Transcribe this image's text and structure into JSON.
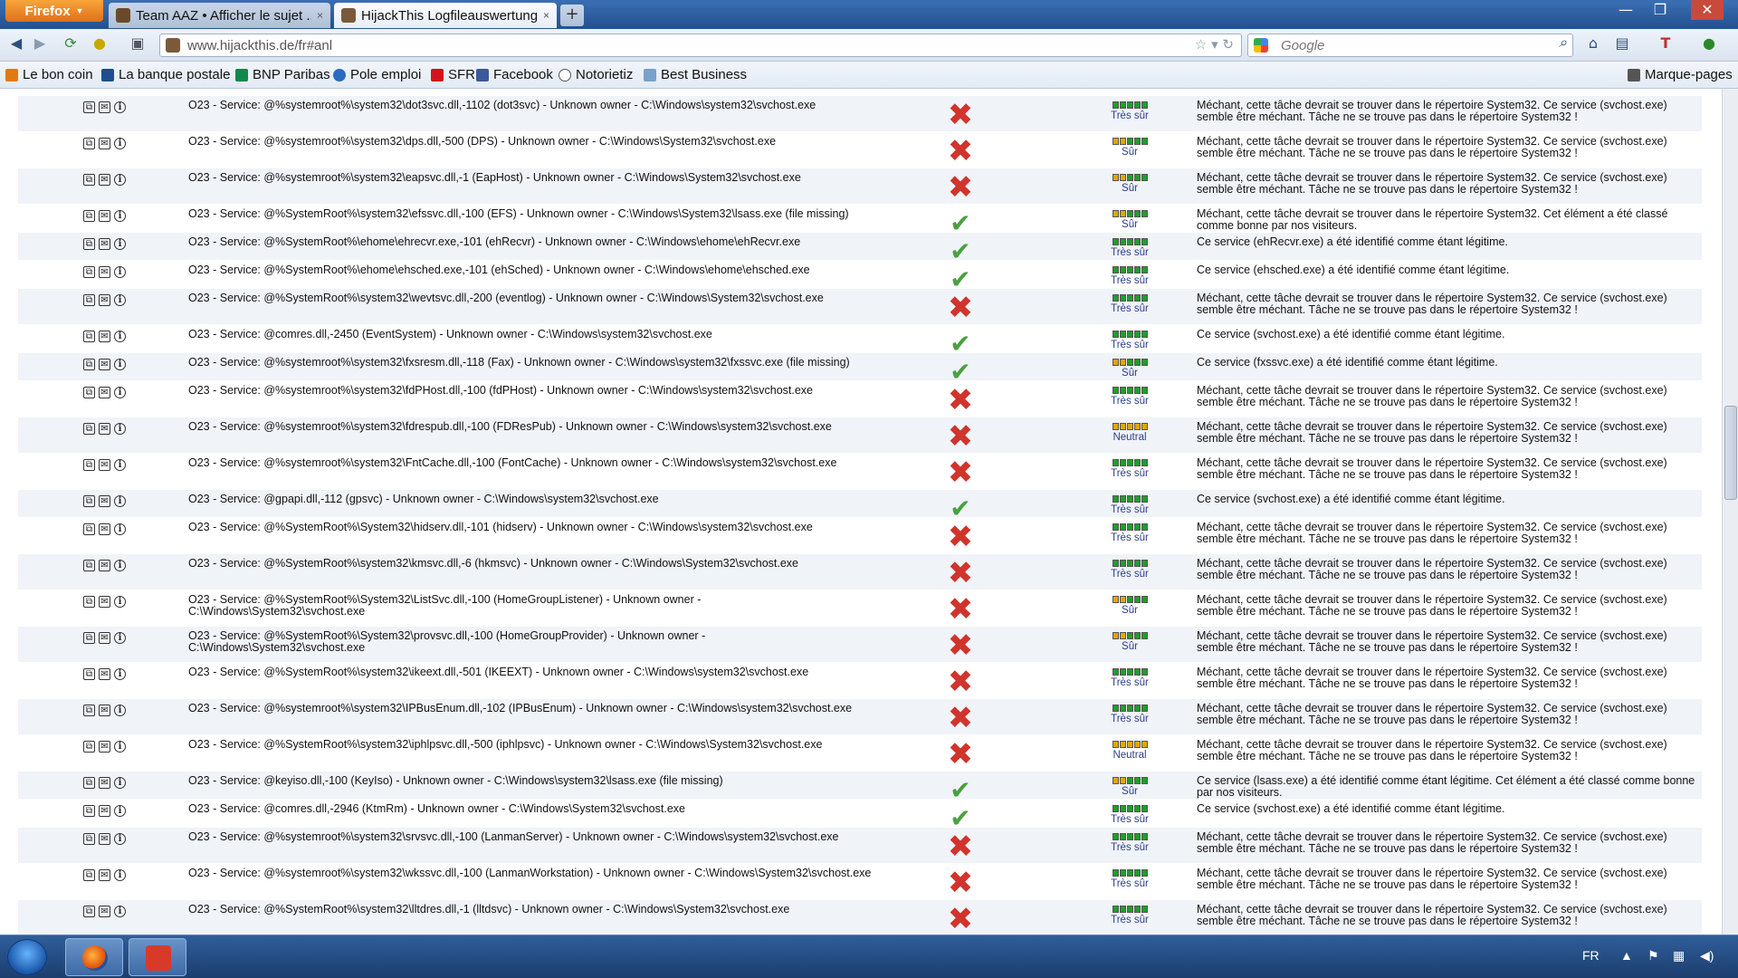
{
  "browser": {
    "menu_label": "Firefox",
    "tabs": [
      {
        "label": "Team AAZ • Afficher le sujet ...",
        "close": "×"
      },
      {
        "label": "HijackThis Logfileauswertung",
        "close": "×"
      }
    ],
    "newtab": "+",
    "url": "www.hijackthis.de/fr#anl",
    "search_placeholder": "Google",
    "bookmarks": [
      {
        "label": "Le bon coin",
        "color": "#e07a10"
      },
      {
        "label": "La banque postale",
        "color": "#1f4d8f"
      },
      {
        "label": "BNP Paribas",
        "color": "#0f8a4a"
      },
      {
        "label": "Pole emploi",
        "color": "#2a6bbf"
      },
      {
        "label": "SFR",
        "color": "#d4131b"
      },
      {
        "label": "Facebook",
        "color": "#3b5998"
      },
      {
        "label": "Notorietiz",
        "color": "#555555"
      },
      {
        "label": "Best Business",
        "color": "#7aa0cc"
      }
    ],
    "bookmarks_menu": "Marque-pages"
  },
  "rows": [
    {
      "entry": "O23 - Service: @%systemroot%\\system32\\dot3svc.dll,-1102 (dot3svc) - Unknown owner - C:\\Windows\\system32\\svchost.exe",
      "status": "bad",
      "rating": "Très sûr",
      "desc": "Méchant, cette tâche devrait se trouver dans le répertoire System32. Ce service (svchost.exe) semble être méchant. Tâche ne se trouve pas dans le répertoire System32 !"
    },
    {
      "entry": "O23 - Service: @%systemroot%\\system32\\dps.dll,-500 (DPS) - Unknown owner - C:\\Windows\\System32\\svchost.exe",
      "status": "bad",
      "rating": "Sûr",
      "desc": "Méchant, cette tâche devrait se trouver dans le répertoire System32. Ce service (svchost.exe) semble être méchant. Tâche ne se trouve pas dans le répertoire System32 !"
    },
    {
      "entry": "O23 - Service: @%systemroot%\\system32\\eapsvc.dll,-1 (EapHost) - Unknown owner - C:\\Windows\\System32\\svchost.exe",
      "status": "bad",
      "rating": "Sûr",
      "desc": "Méchant, cette tâche devrait se trouver dans le répertoire System32. Ce service (svchost.exe) semble être méchant. Tâche ne se trouve pas dans le répertoire System32 !"
    },
    {
      "entry": "O23 - Service: @%SystemRoot%\\system32\\efssvc.dll,-100 (EFS) - Unknown owner - C:\\Windows\\System32\\lsass.exe (file missing)",
      "status": "good",
      "rating": "Sûr",
      "desc": "Méchant, cette tâche devrait se trouver dans le répertoire System32. Cet élément a été classé comme bonne par nos visiteurs."
    },
    {
      "entry": "O23 - Service: @%SystemRoot%\\ehome\\ehrecvr.exe,-101 (ehRecvr) - Unknown owner - C:\\Windows\\ehome\\ehRecvr.exe",
      "status": "good",
      "rating": "Très sûr",
      "desc": "Ce service (ehRecvr.exe) a été identifié comme étant légitime."
    },
    {
      "entry": "O23 - Service: @%SystemRoot%\\ehome\\ehsched.exe,-101 (ehSched) - Unknown owner - C:\\Windows\\ehome\\ehsched.exe",
      "status": "good",
      "rating": "Très sûr",
      "desc": "Ce service (ehsched.exe) a été identifié comme étant légitime."
    },
    {
      "entry": "O23 - Service: @%SystemRoot%\\system32\\wevtsvc.dll,-200 (eventlog) - Unknown owner - C:\\Windows\\System32\\svchost.exe",
      "status": "bad",
      "rating": "Très sûr",
      "desc": "Méchant, cette tâche devrait se trouver dans le répertoire System32. Ce service (svchost.exe) semble être méchant. Tâche ne se trouve pas dans le répertoire System32 !"
    },
    {
      "entry": "O23 - Service: @comres.dll,-2450 (EventSystem) - Unknown owner - C:\\Windows\\system32\\svchost.exe",
      "status": "good",
      "rating": "Très sûr",
      "desc": "Ce service (svchost.exe) a été identifié comme étant légitime."
    },
    {
      "entry": "O23 - Service: @%systemroot%\\system32\\fxsresm.dll,-118 (Fax) - Unknown owner - C:\\Windows\\system32\\fxssvc.exe (file missing)",
      "status": "good",
      "rating": "Sûr",
      "desc": "Ce service (fxssvc.exe) a été identifié comme étant légitime."
    },
    {
      "entry": "O23 - Service: @%systemroot%\\system32\\fdPHost.dll,-100 (fdPHost) - Unknown owner - C:\\Windows\\system32\\svchost.exe",
      "status": "bad",
      "rating": "Très sûr",
      "desc": "Méchant, cette tâche devrait se trouver dans le répertoire System32. Ce service (svchost.exe) semble être méchant. Tâche ne se trouve pas dans le répertoire System32 !"
    },
    {
      "entry": "O23 - Service: @%systemroot%\\system32\\fdrespub.dll,-100 (FDResPub) - Unknown owner - C:\\Windows\\system32\\svchost.exe",
      "status": "bad",
      "rating": "Neutral",
      "desc": "Méchant, cette tâche devrait se trouver dans le répertoire System32. Ce service (svchost.exe) semble être méchant. Tâche ne se trouve pas dans le répertoire System32 !"
    },
    {
      "entry": "O23 - Service: @%systemroot%\\system32\\FntCache.dll,-100 (FontCache) - Unknown owner - C:\\Windows\\system32\\svchost.exe",
      "status": "bad",
      "rating": "Très sûr",
      "desc": "Méchant, cette tâche devrait se trouver dans le répertoire System32. Ce service (svchost.exe) semble être méchant. Tâche ne se trouve pas dans le répertoire System32 !"
    },
    {
      "entry": "O23 - Service: @gpapi.dll,-112 (gpsvc) - Unknown owner - C:\\Windows\\system32\\svchost.exe",
      "status": "good",
      "rating": "Très sûr",
      "desc": "Ce service (svchost.exe) a été identifié comme étant légitime."
    },
    {
      "entry": "O23 - Service: @%SystemRoot%\\System32\\hidserv.dll,-101 (hidserv) - Unknown owner - C:\\Windows\\system32\\svchost.exe",
      "status": "bad",
      "rating": "Très sûr",
      "desc": "Méchant, cette tâche devrait se trouver dans le répertoire System32. Ce service (svchost.exe) semble être méchant. Tâche ne se trouve pas dans le répertoire System32 !"
    },
    {
      "entry": "O23 - Service: @%SystemRoot%\\system32\\kmsvc.dll,-6 (hkmsvc) - Unknown owner - C:\\Windows\\System32\\svchost.exe",
      "status": "bad",
      "rating": "Très sûr",
      "desc": "Méchant, cette tâche devrait se trouver dans le répertoire System32. Ce service (svchost.exe) semble être méchant. Tâche ne se trouve pas dans le répertoire System32 !"
    },
    {
      "entry": "O23 - Service: @%SystemRoot%\\System32\\ListSvc.dll,-100 (HomeGroupListener) - Unknown owner - C:\\Windows\\System32\\svchost.exe",
      "status": "bad",
      "rating": "Sûr",
      "desc": "Méchant, cette tâche devrait se trouver dans le répertoire System32. Ce service (svchost.exe) semble être méchant. Tâche ne se trouve pas dans le répertoire System32 !"
    },
    {
      "entry": "O23 - Service: @%SystemRoot%\\System32\\provsvc.dll,-100 (HomeGroupProvider) - Unknown owner - C:\\Windows\\System32\\svchost.exe",
      "status": "bad",
      "rating": "Sûr",
      "desc": "Méchant, cette tâche devrait se trouver dans le répertoire System32. Ce service (svchost.exe) semble être méchant. Tâche ne se trouve pas dans le répertoire System32 !"
    },
    {
      "entry": "O23 - Service: @%SystemRoot%\\system32\\ikeext.dll,-501 (IKEEXT) - Unknown owner - C:\\Windows\\system32\\svchost.exe",
      "status": "bad",
      "rating": "Très sûr",
      "desc": "Méchant, cette tâche devrait se trouver dans le répertoire System32. Ce service (svchost.exe) semble être méchant. Tâche ne se trouve pas dans le répertoire System32 !"
    },
    {
      "entry": "O23 - Service: @%systemroot%\\system32\\IPBusEnum.dll,-102 (IPBusEnum) - Unknown owner - C:\\Windows\\system32\\svchost.exe",
      "status": "bad",
      "rating": "Très sûr",
      "desc": "Méchant, cette tâche devrait se trouver dans le répertoire System32. Ce service (svchost.exe) semble être méchant. Tâche ne se trouve pas dans le répertoire System32 !"
    },
    {
      "entry": "O23 - Service: @%SystemRoot%\\system32\\iphlpsvc.dll,-500 (iphlpsvc) - Unknown owner - C:\\Windows\\System32\\svchost.exe",
      "status": "bad",
      "rating": "Neutral",
      "desc": "Méchant, cette tâche devrait se trouver dans le répertoire System32. Ce service (svchost.exe) semble être méchant. Tâche ne se trouve pas dans le répertoire System32 !"
    },
    {
      "entry": "O23 - Service: @keyiso.dll,-100 (KeyIso) - Unknown owner - C:\\Windows\\system32\\lsass.exe (file missing)",
      "status": "good",
      "rating": "Sûr",
      "desc": "Ce service (lsass.exe) a été identifié comme étant légitime. Cet élément a été classé comme bonne par nos visiteurs."
    },
    {
      "entry": "O23 - Service: @comres.dll,-2946 (KtmRm) - Unknown owner - C:\\Windows\\System32\\svchost.exe",
      "status": "good",
      "rating": "Très sûr",
      "desc": "Ce service (svchost.exe) a été identifié comme étant légitime."
    },
    {
      "entry": "O23 - Service: @%systemroot%\\system32\\srvsvc.dll,-100 (LanmanServer) - Unknown owner - C:\\Windows\\system32\\svchost.exe",
      "status": "bad",
      "rating": "Très sûr",
      "desc": "Méchant, cette tâche devrait se trouver dans le répertoire System32. Ce service (svchost.exe) semble être méchant. Tâche ne se trouve pas dans le répertoire System32 !"
    },
    {
      "entry": "O23 - Service: @%systemroot%\\system32\\wkssvc.dll,-100 (LanmanWorkstation) - Unknown owner - C:\\Windows\\System32\\svchost.exe",
      "status": "bad",
      "rating": "Très sûr",
      "desc": "Méchant, cette tâche devrait se trouver dans le répertoire System32. Ce service (svchost.exe) semble être méchant. Tâche ne se trouve pas dans le répertoire System32 !"
    },
    {
      "entry": "O23 - Service: @%SystemRoot%\\system32\\lltdres.dll,-1 (lltdsvc) - Unknown owner - C:\\Windows\\System32\\svchost.exe",
      "status": "bad",
      "rating": "Très sûr",
      "desc": "Méchant, cette tâche devrait se trouver dans le répertoire System32. Ce service (svchost.exe) semble être méchant. Tâche ne se trouve pas dans le répertoire System32 !"
    }
  ],
  "taskbar": {
    "lang": "FR"
  }
}
